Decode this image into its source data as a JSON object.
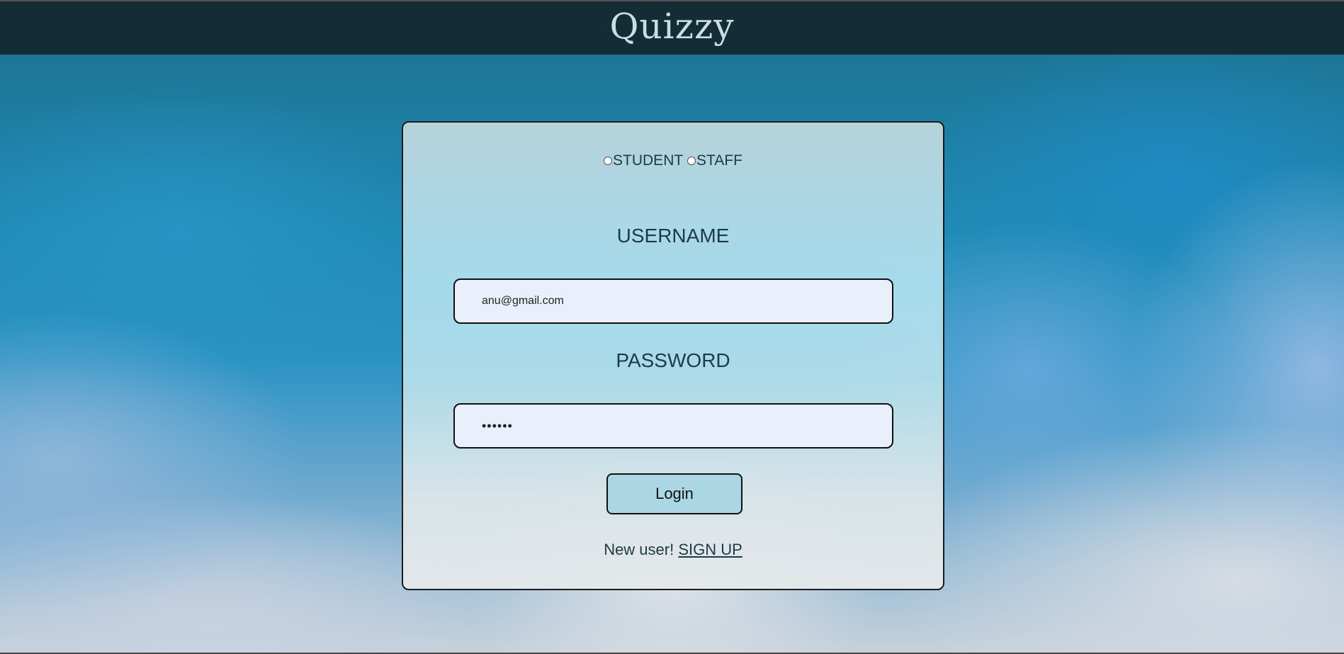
{
  "header": {
    "title": "Quizzy"
  },
  "login": {
    "roles": [
      {
        "label": "STUDENT",
        "selected": false
      },
      {
        "label": "STAFF",
        "selected": false
      }
    ],
    "username_label": "USERNAME",
    "username_value": "anu@gmail.com",
    "password_label": "PASSWORD",
    "password_value": "••••••",
    "login_button": "Login",
    "signup_prompt": "New user! ",
    "signup_link": "SIGN UP"
  }
}
